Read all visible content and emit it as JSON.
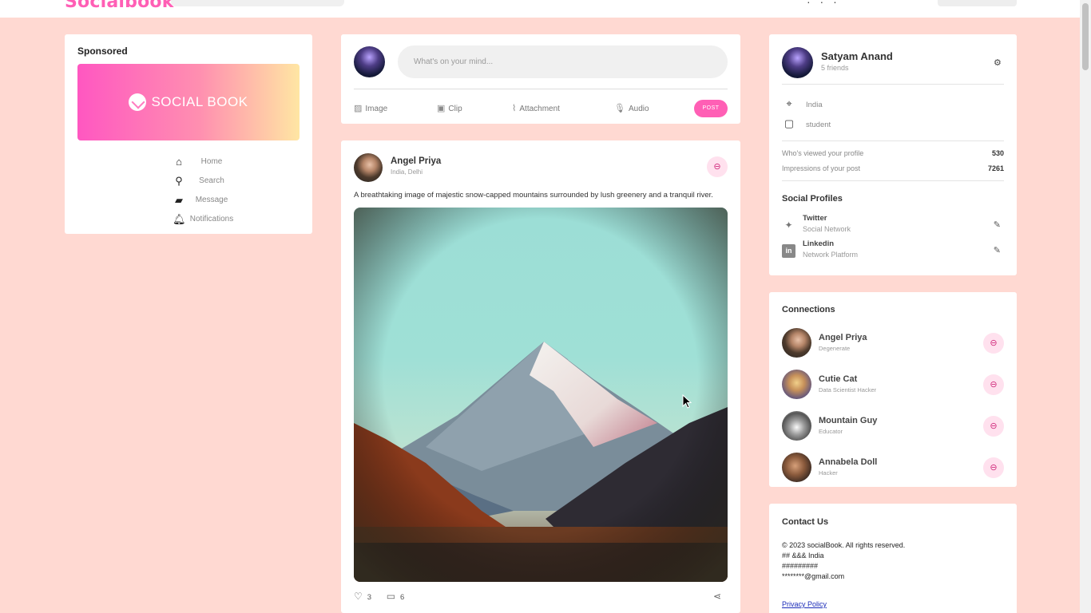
{
  "topnav": {
    "logo": "Socialbook"
  },
  "left": {
    "sponsored_title": "Sponsored",
    "banner_text": "SOCIAL BOOK",
    "menu": [
      {
        "icon": "home-icon",
        "label": "Home"
      },
      {
        "icon": "search-icon",
        "label": "Search"
      },
      {
        "icon": "message-icon",
        "label": "Message"
      },
      {
        "icon": "bell-icon",
        "label": "Notifications"
      }
    ]
  },
  "composer": {
    "placeholder": "What's on your mind...",
    "actions": [
      "Image",
      "Clip",
      "Attachment",
      "Audio"
    ],
    "post_label": "POST"
  },
  "post": {
    "author": "Angel Priya",
    "location": "India, Delhi",
    "caption": "A breathtaking image of majestic snow-capped mountains surrounded by lush greenery and a tranquil river.",
    "likes": "3",
    "comments": "6"
  },
  "profile": {
    "name": "Satyam Anand",
    "friends": "5 friends",
    "location": "India",
    "occupation": "student",
    "stats": [
      {
        "label": "Who's viewed your profile",
        "value": "530"
      },
      {
        "label": "Impressions of your post",
        "value": "7261"
      }
    ],
    "social_title": "Social Profiles",
    "social": [
      {
        "name": "Twitter",
        "type": "Social Network"
      },
      {
        "name": "Linkedin",
        "type": "Network Platform"
      }
    ]
  },
  "connections": {
    "title": "Connections",
    "items": [
      {
        "name": "Angel Priya",
        "role": "Degenerate"
      },
      {
        "name": "Cutie Cat",
        "role": "Data Scientist Hacker"
      },
      {
        "name": "Mountain Guy",
        "role": "Educator"
      },
      {
        "name": "Annabela Doll",
        "role": "Hacker"
      }
    ]
  },
  "contact": {
    "title": "Contact Us",
    "lines": [
      "© 2023 socialBook. All rights reserved.",
      "## &&& India",
      "#########",
      "********@gmail.com"
    ],
    "privacy": "Privacy Policy"
  },
  "colors": {
    "accent": "#ff5fb5",
    "background": "#ffd9d2",
    "accent_soft": "#ffe1ee"
  }
}
